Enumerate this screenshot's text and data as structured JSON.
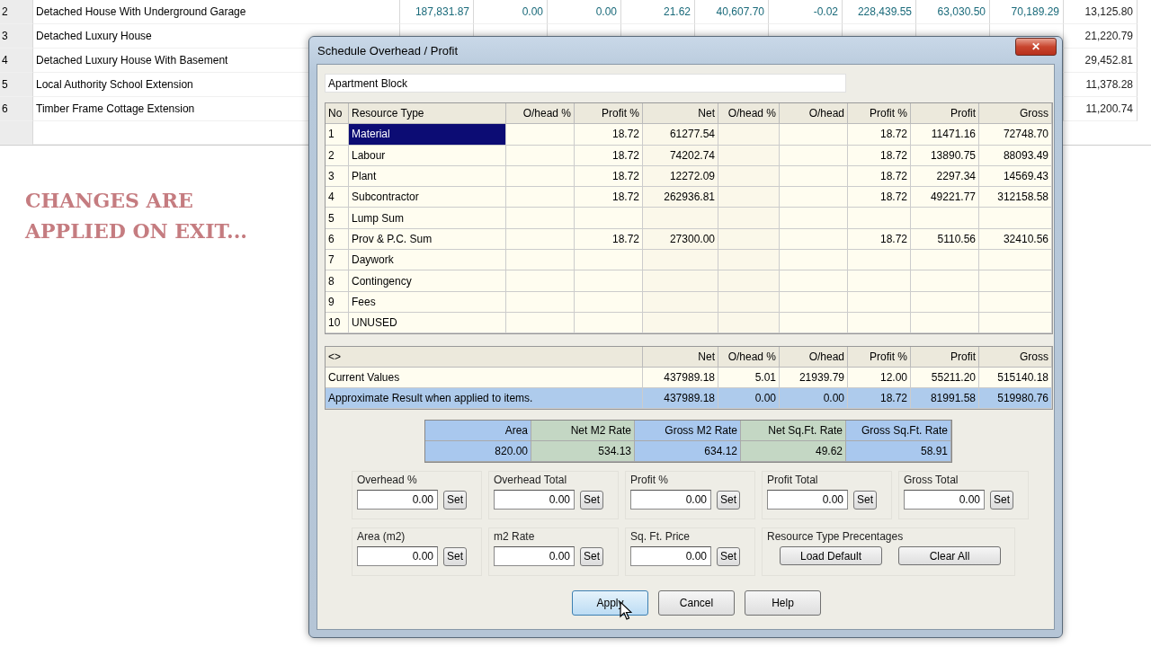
{
  "background_table": {
    "rows": [
      {
        "no": "2",
        "name": "Detached House With Underground Garage",
        "values": [
          "187,831.87",
          "0.00",
          "0.00",
          "21.62",
          "40,607.70",
          "-0.02",
          "228,439.55",
          "63,030.50",
          "70,189.29",
          "13,125.80"
        ]
      },
      {
        "no": "3",
        "name": "Detached Luxury House",
        "values": [
          "21,220.79"
        ]
      },
      {
        "no": "4",
        "name": "Detached Luxury House With Basement",
        "values": [
          "29,452.81"
        ]
      },
      {
        "no": "5",
        "name": "Local Authority School Extension",
        "values": [
          "11,378.28"
        ]
      },
      {
        "no": "6",
        "name": "Timber Frame Cottage Extension",
        "values": [
          "11,200.74"
        ]
      }
    ]
  },
  "caption": [
    "CHANGES ARE",
    "APPLIED ON EXIT..."
  ],
  "dialog": {
    "title": "Schedule Overhead / Profit",
    "close": "✕",
    "name_field": "Apartment Block",
    "table": {
      "columns": [
        "No",
        "Resource Type",
        "O/head %",
        "Profit %",
        "Net",
        "O/head %",
        "O/head",
        "Profit %",
        "Profit",
        "Gross"
      ],
      "rows": [
        {
          "selected": true,
          "cells": [
            "1",
            "Material",
            "",
            "18.72",
            "61277.54",
            "",
            "",
            "18.72",
            "11471.16",
            "72748.70"
          ]
        },
        {
          "selected": false,
          "cells": [
            "2",
            "Labour",
            "",
            "18.72",
            "74202.74",
            "",
            "",
            "18.72",
            "13890.75",
            "88093.49"
          ]
        },
        {
          "selected": false,
          "cells": [
            "3",
            "Plant",
            "",
            "18.72",
            "12272.09",
            "",
            "",
            "18.72",
            "2297.34",
            "14569.43"
          ]
        },
        {
          "selected": false,
          "cells": [
            "4",
            "Subcontractor",
            "",
            "18.72",
            "262936.81",
            "",
            "",
            "18.72",
            "49221.77",
            "312158.58"
          ]
        },
        {
          "selected": false,
          "cells": [
            "5",
            "Lump Sum",
            "",
            "",
            "",
            "",
            "",
            "",
            "",
            ""
          ]
        },
        {
          "selected": false,
          "cells": [
            "6",
            "Prov & P.C. Sum",
            "",
            "18.72",
            "27300.00",
            "",
            "",
            "18.72",
            "5110.56",
            "32410.56"
          ]
        },
        {
          "selected": false,
          "cells": [
            "7",
            "Daywork",
            "",
            "",
            "",
            "",
            "",
            "",
            "",
            ""
          ]
        },
        {
          "selected": false,
          "cells": [
            "8",
            "Contingency",
            "",
            "",
            "",
            "",
            "",
            "",
            "",
            ""
          ]
        },
        {
          "selected": false,
          "cells": [
            "9",
            "Fees",
            "",
            "",
            "",
            "",
            "",
            "",
            "",
            ""
          ]
        },
        {
          "selected": false,
          "cells": [
            "10",
            "UNUSED",
            "",
            "",
            "",
            "",
            "",
            "",
            "",
            ""
          ]
        }
      ]
    },
    "summary": {
      "columns": [
        "<>",
        "Net",
        "O/head %",
        "O/head",
        "Profit %",
        "Profit",
        "Gross"
      ],
      "rows": [
        {
          "selected": false,
          "cells": [
            "Current Values",
            "437989.18",
            "5.01",
            "21939.79",
            "12.00",
            "55211.20",
            "515140.18"
          ]
        },
        {
          "selected": true,
          "cells": [
            "Approximate Result when applied to items.",
            "437989.18",
            "0.00",
            "0.00",
            "18.72",
            "81991.58",
            "519980.76"
          ]
        }
      ]
    },
    "rates": {
      "columns": [
        "Area",
        "Net M2 Rate",
        "Gross M2 Rate",
        "Net Sq.Ft. Rate",
        "Gross Sq.Ft. Rate"
      ],
      "values": [
        "820.00",
        "534.13",
        "634.12",
        "49.62",
        "58.91"
      ]
    },
    "fields": [
      {
        "label": "Overhead %",
        "value": "0.00",
        "button": "Set"
      },
      {
        "label": "Overhead Total",
        "value": "0.00",
        "button": "Set"
      },
      {
        "label": "Profit %",
        "value": "0.00",
        "button": "Set"
      },
      {
        "label": "Profit Total",
        "value": "0.00",
        "button": "Set"
      },
      {
        "label": "Gross Total",
        "value": "0.00",
        "button": "Set"
      },
      {
        "label": "Area (m2)",
        "value": "0.00",
        "button": "Set"
      },
      {
        "label": "m2 Rate",
        "value": "0.00",
        "button": "Set"
      },
      {
        "label": "Sq. Ft. Price",
        "value": "0.00",
        "button": "Set"
      }
    ],
    "resource_group": {
      "label": "Resource Type Precentages",
      "buttons": [
        "Load Default",
        "Clear All"
      ]
    },
    "buttons": [
      {
        "label": "Apply",
        "selected": true
      },
      {
        "label": "Cancel",
        "selected": false
      },
      {
        "label": "Help",
        "selected": false
      }
    ]
  }
}
